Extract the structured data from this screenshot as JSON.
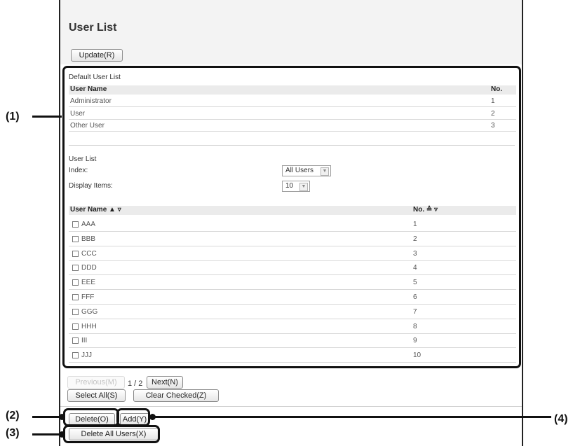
{
  "page": {
    "title": "User List",
    "update_button": "Update(R)"
  },
  "default_list": {
    "section_label": "Default User List",
    "col_name": "User Name",
    "col_no": "No.",
    "rows": [
      {
        "name": "Administrator",
        "no": "1"
      },
      {
        "name": "User",
        "no": "2"
      },
      {
        "name": "Other User",
        "no": "3"
      }
    ]
  },
  "user_list": {
    "section_label": "User List",
    "index_label": "Index:",
    "index_value": "All Users",
    "display_label": "Display Items:",
    "display_value": "10",
    "col_name": "User Name ▲ ▿",
    "col_no": "No. ≙ ▿",
    "rows": [
      {
        "name": "AAA",
        "no": "1"
      },
      {
        "name": "BBB",
        "no": "2"
      },
      {
        "name": "CCC",
        "no": "3"
      },
      {
        "name": "DDD",
        "no": "4"
      },
      {
        "name": "EEE",
        "no": "5"
      },
      {
        "name": "FFF",
        "no": "6"
      },
      {
        "name": "GGG",
        "no": "7"
      },
      {
        "name": "HHH",
        "no": "8"
      },
      {
        "name": "III",
        "no": "9"
      },
      {
        "name": "JJJ",
        "no": "10"
      }
    ]
  },
  "pagination": {
    "previous": "Previous(M)",
    "page_info": "1 / 2",
    "next": "Next(N)",
    "select_all": "Select All(S)",
    "clear_checked": "Clear Checked(Z)"
  },
  "actions": {
    "delete": "Delete(O)",
    "add": "Add(Y)",
    "delete_all": "Delete All Users(X)"
  },
  "callouts": {
    "c1": "(1)",
    "c2": "(2)",
    "c3": "(3)",
    "c4": "(4)"
  }
}
